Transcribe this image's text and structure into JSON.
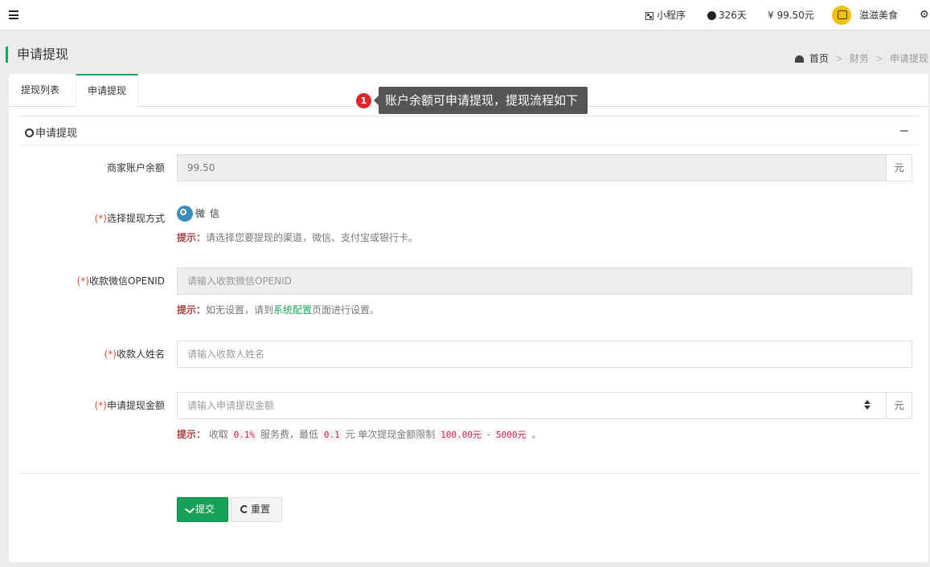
{
  "topbar": {
    "mini_program": "小程序",
    "days": "326天",
    "balance": "¥ 99.50元",
    "shop_name": "滋滋美食"
  },
  "page": {
    "title": "申请提现",
    "breadcrumb": [
      "首页",
      "财务",
      "申请提现"
    ],
    "breadcrumb_sep": ">"
  },
  "tabs": [
    {
      "label": "提现列表",
      "active": false
    },
    {
      "label": "申请提现",
      "active": true
    }
  ],
  "tooltip": {
    "step": "1",
    "text": "账户余额可申请提现，提现流程如下"
  },
  "box": {
    "title": "申请提现"
  },
  "form": {
    "required_mark": "(*)",
    "balance": {
      "label": "商家账户余额",
      "value": "99.50",
      "unit": "元"
    },
    "method": {
      "label": "选择提现方式",
      "option": "微信",
      "tip_label": "提示：",
      "tip": "请选择您要提现的渠道，微信、支付宝或银行卡。"
    },
    "openid": {
      "label": "收款微信OPENID",
      "placeholder": "请输入收款微信OPENID",
      "tip_label": "提示：",
      "tip_before": "如无设置，请到",
      "tip_link": "系统配置",
      "tip_after": "页面进行设置。"
    },
    "name": {
      "label": "收款人姓名",
      "placeholder": "请输入收款人姓名"
    },
    "amount": {
      "label": "申请提现金额",
      "placeholder": "请输入申请提现金额",
      "unit": "元",
      "tip_label": "提示：",
      "tip_part1": "收取",
      "fee": "0.1%",
      "tip_part2": "服务费，最低",
      "min_fee": "0.1",
      "tip_part3": "元 单次提现金额限制",
      "min": "100.00元",
      "dash": "-",
      "max": "5000元",
      "tip_end": "。"
    }
  },
  "buttons": {
    "submit": "提交",
    "reset": "重置"
  },
  "colors": {
    "accent": "#1ba45c",
    "radio": "#3c8dbc",
    "tip_label": "#a94442",
    "badge": "#e0262d"
  }
}
